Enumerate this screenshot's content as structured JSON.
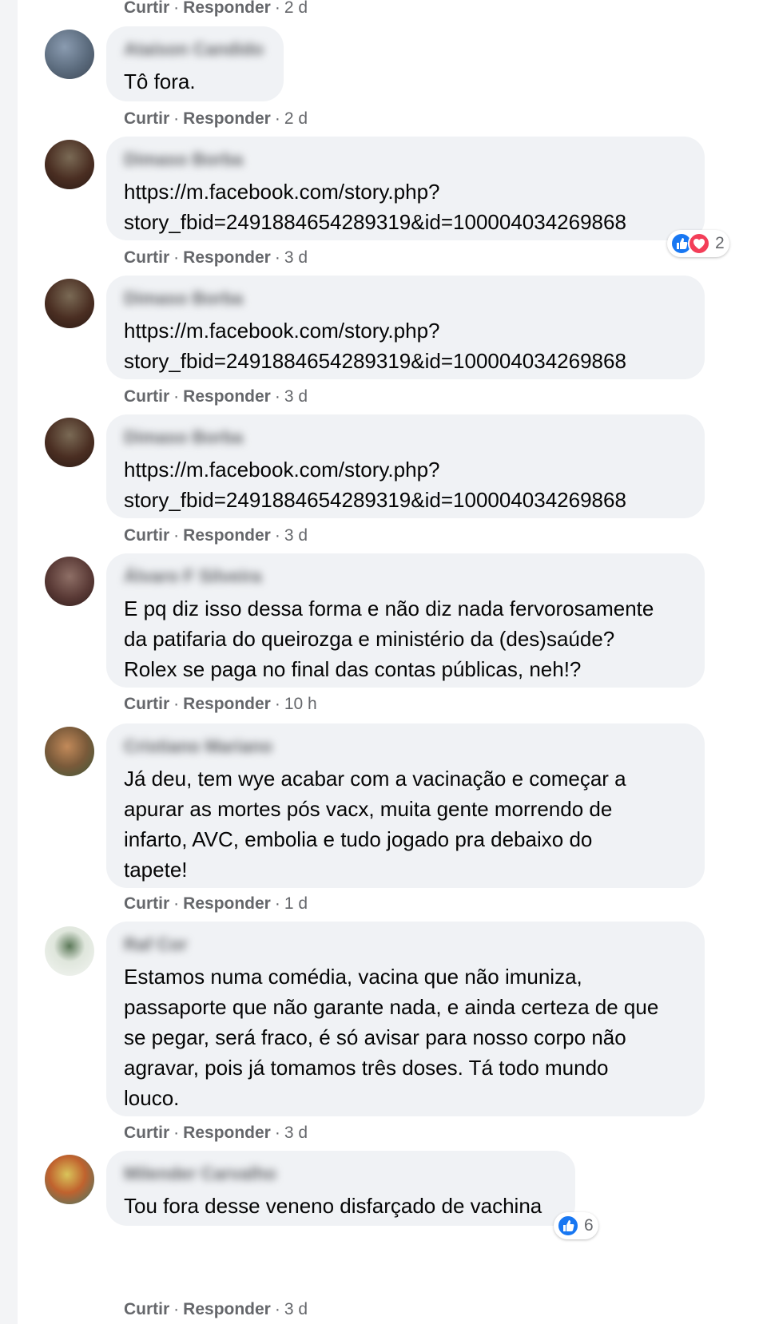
{
  "colors": {
    "bubble": "#f0f2f5",
    "meta_text": "#65676b",
    "like_blue": "#1877f2",
    "love_red": "#f33e58"
  },
  "actions": {
    "like_label": "Curtir",
    "reply_label": "Responder",
    "separator": "·"
  },
  "comments": [
    {
      "author": "Ataíson Candido",
      "lines": [],
      "age": "2 d"
    },
    {
      "author": "Ataíson Candido",
      "lines": [
        "Tô fora."
      ],
      "age": "2 d"
    },
    {
      "author": "Dimaso Borba",
      "lines": [
        "https://m.facebook.com/story.php?",
        "story_fbid=2491884654289319&id=100004034269868"
      ],
      "age": "3 d",
      "reaction_count": "2",
      "reaction_icons": [
        "like-icon",
        "love-icon"
      ]
    },
    {
      "author": "Dimaso Borba",
      "lines": [
        "https://m.facebook.com/story.php?",
        "story_fbid=2491884654289319&id=100004034269868"
      ],
      "age": "3 d"
    },
    {
      "author": "Dimaso Borba",
      "lines": [
        "https://m.facebook.com/story.php?",
        "story_fbid=2491884654289319&id=100004034269868"
      ],
      "age": "3 d"
    },
    {
      "author": "Álvaro F Silveira",
      "lines": [
        "E pq diz isso dessa forma e não diz nada fervorosamente",
        "da patifaria do queirozga e ministério da (des)saúde?",
        "Rolex se paga no final das contas públicas, neh!?"
      ],
      "age": "10 h"
    },
    {
      "author": "Cristiano Mariano",
      "lines": [
        "Já deu, tem wye acabar com a vacinação e começar a",
        "apurar as mortes pós vacx, muita gente morrendo de",
        "infarto, AVC, embolia e tudo jogado pra debaixo do",
        "tapete!"
      ],
      "age": "1 d"
    },
    {
      "author": "Raf Cor",
      "lines": [
        "Estamos numa comédia, vacina que não imuniza,",
        "passaporte que não garante nada, e ainda certeza de que",
        "se pegar, será fraco, é só avisar para nosso corpo não",
        "agravar, pois já tomamos três doses. Tá todo mundo",
        "louco."
      ],
      "age": "3 d"
    },
    {
      "author": "Milender Carvalho",
      "lines": [
        "Tou fora desse veneno disfarçado de vachina"
      ],
      "age": "3 d",
      "reaction_count": "6",
      "reaction_icons": [
        "like-icon"
      ]
    }
  ]
}
